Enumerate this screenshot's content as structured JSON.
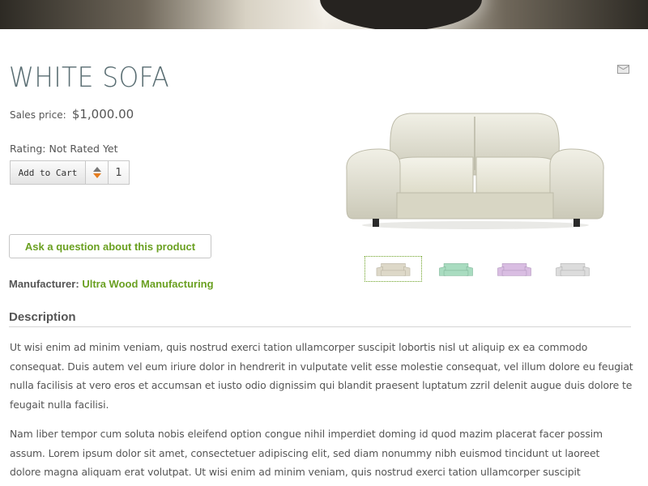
{
  "product": {
    "title": "WHITE SOFA",
    "sales_price_label": "Sales price:",
    "sales_price_value": "$1,000.00",
    "rating_label": "Rating:",
    "rating_value": "Not Rated Yet"
  },
  "cart": {
    "add_label": "Add to Cart",
    "quantity": "1"
  },
  "ask_question_label": "Ask a question about this product",
  "manufacturer": {
    "label": "Manufacturer:",
    "name": "Ultra Wood Manufacturing"
  },
  "description": {
    "heading": "Description",
    "paragraphs": [
      "Ut wisi enim ad minim veniam, quis nostrud exerci tation ullamcorper suscipit lobortis nisl ut aliquip ex ea commodo consequat. Duis autem vel eum iriure dolor in hendrerit in vulputate velit esse molestie consequat, vel illum dolore eu feugiat nulla facilisis at vero eros et accumsan et iusto odio dignissim qui blandit praesent luptatum zzril delenit augue duis dolore te feugait nulla facilisi.",
      "Nam liber tempor cum soluta nobis eleifend option congue nihil imperdiet doming id quod mazim placerat facer possim assum. Lorem ipsum dolor sit amet, consectetuer adipiscing elit, sed diam nonummy nibh euismod tincidunt ut laoreet dolore magna aliquam erat volutpat. Ut wisi enim ad minim veniam, quis nostrud exerci tation ullamcorper suscipit"
    ]
  },
  "thumbnails": [
    {
      "name": "sofa-cream",
      "color": "#ddd8c8"
    },
    {
      "name": "sofa-green",
      "color": "#a9dcc0"
    },
    {
      "name": "sofa-purple",
      "color": "#d9bde2"
    },
    {
      "name": "sofa-grey",
      "color": "#dcdcdc"
    }
  ],
  "colors": {
    "accent_green": "#6aa021",
    "title_color": "#5a6e73",
    "spinner_down": "#e57d1f"
  },
  "icons": {
    "email": "email-icon"
  }
}
